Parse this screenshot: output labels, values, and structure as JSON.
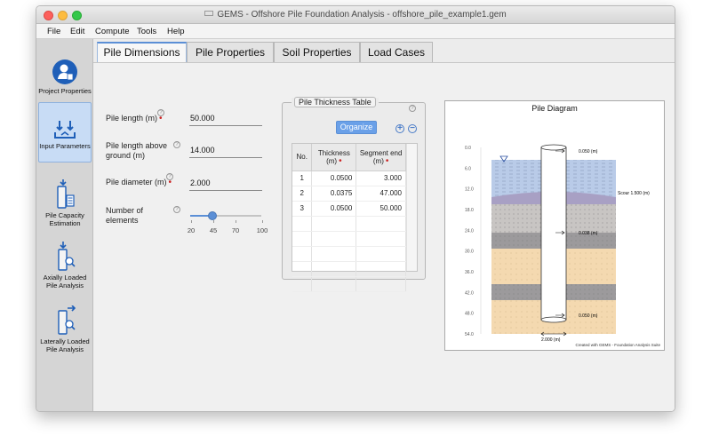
{
  "window": {
    "title": "GEMS - Offshore Pile Foundation Analysis - offshore_pile_example1.gem"
  },
  "menu": [
    "File",
    "Edit",
    "Compute",
    "Tools",
    "Help"
  ],
  "sidebar": {
    "items": [
      {
        "label": "Project Properties",
        "icon": "user-icon"
      },
      {
        "label": "Input Parameters",
        "icon": "download-arrows-icon"
      },
      {
        "label": "Pile Capacity Estimation",
        "icon": "pile-calculator-icon"
      },
      {
        "label": "Axially Loaded Pile Analysis",
        "icon": "pile-axial-icon"
      },
      {
        "label": "Laterally Loaded Pile Analysis",
        "icon": "pile-lateral-icon"
      }
    ],
    "active_index": 1,
    "accent_color": "#1f5fb8"
  },
  "tabs": [
    {
      "label": "Pile Dimensions",
      "active": true
    },
    {
      "label": "Pile Properties",
      "active": false
    },
    {
      "label": "Soil Properties",
      "active": false
    },
    {
      "label": "Load Cases",
      "active": false
    }
  ],
  "form": {
    "pile_length": {
      "label": "Pile length (m)",
      "value": "50.000"
    },
    "pile_length_above": {
      "label_line1": "Pile length above",
      "label_line2": "ground (m)",
      "value": "14.000"
    },
    "pile_diameter": {
      "label": "Pile diameter (m)",
      "value": "2.000"
    },
    "elements": {
      "label_line1": "Number of",
      "label_line2": "elements",
      "slider_min": 20,
      "slider_max": 100,
      "slider_value": 45,
      "tick_labels": [
        "20",
        "45",
        "70",
        "100"
      ]
    }
  },
  "thickness_table": {
    "title": "Pile Thickness Table",
    "organize_label": "Organize",
    "add_symbol": "+",
    "remove_symbol": "−",
    "headers": [
      "No.",
      "Thickness (m)",
      "Segment end (m)"
    ],
    "rows": [
      [
        "1",
        "0.0500",
        "3.000"
      ],
      [
        "2",
        "0.0375",
        "47.000"
      ],
      [
        "3",
        "0.0500",
        "50.000"
      ]
    ]
  },
  "diagram": {
    "title": "Pile Diagram",
    "depth_labels": [
      "0.0",
      "6.0",
      "12.0",
      "18.0",
      "24.0",
      "30.0",
      "36.0",
      "42.0",
      "48.0",
      "54.0"
    ],
    "callouts": [
      "0.050 (m)",
      "Scour 1.500 (m)",
      "0.038 (m)",
      "0.050 (m)"
    ],
    "diameter_label": "2.000 (m)",
    "footer": "Created with GEMS - Foundation Analysis Suite",
    "colors": {
      "water": "#b9cbe8",
      "scour": "#a8a0c4",
      "clay": "#c8c5c3",
      "dense": "#9c9a9c",
      "sand": "#f4d9b0",
      "pile_outline": "#333333"
    }
  },
  "help_symbol": "?",
  "required_symbol": "•"
}
